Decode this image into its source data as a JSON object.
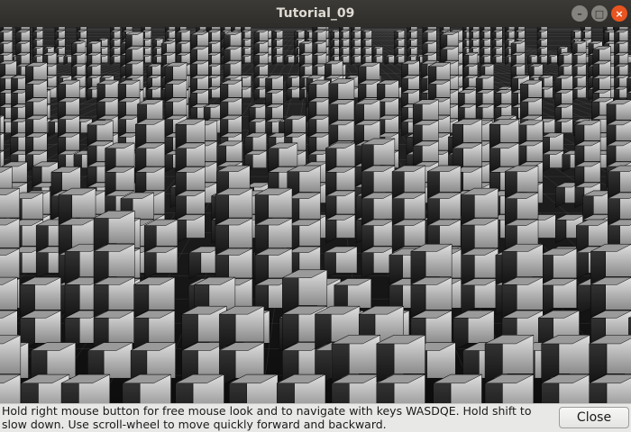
{
  "window": {
    "title": "Tutorial_09",
    "minimize_glyph": "–",
    "maximize_glyph": "□",
    "close_glyph": "×"
  },
  "viewport": {
    "scene": "3d-block-city",
    "colors": {
      "background": "#1a1a1a",
      "lit_face": "#c8c8c8",
      "shaded_face": "#2a2a2a",
      "top_face": "#9a9a9a",
      "grid": "#8a8a8a"
    }
  },
  "footer": {
    "help_text": "Hold right mouse button for free mouse look and to navigate with keys WASDQE. Hold shift to slow down. Use scroll-wheel to move quickly forward and backward.",
    "close_label": "Close"
  }
}
